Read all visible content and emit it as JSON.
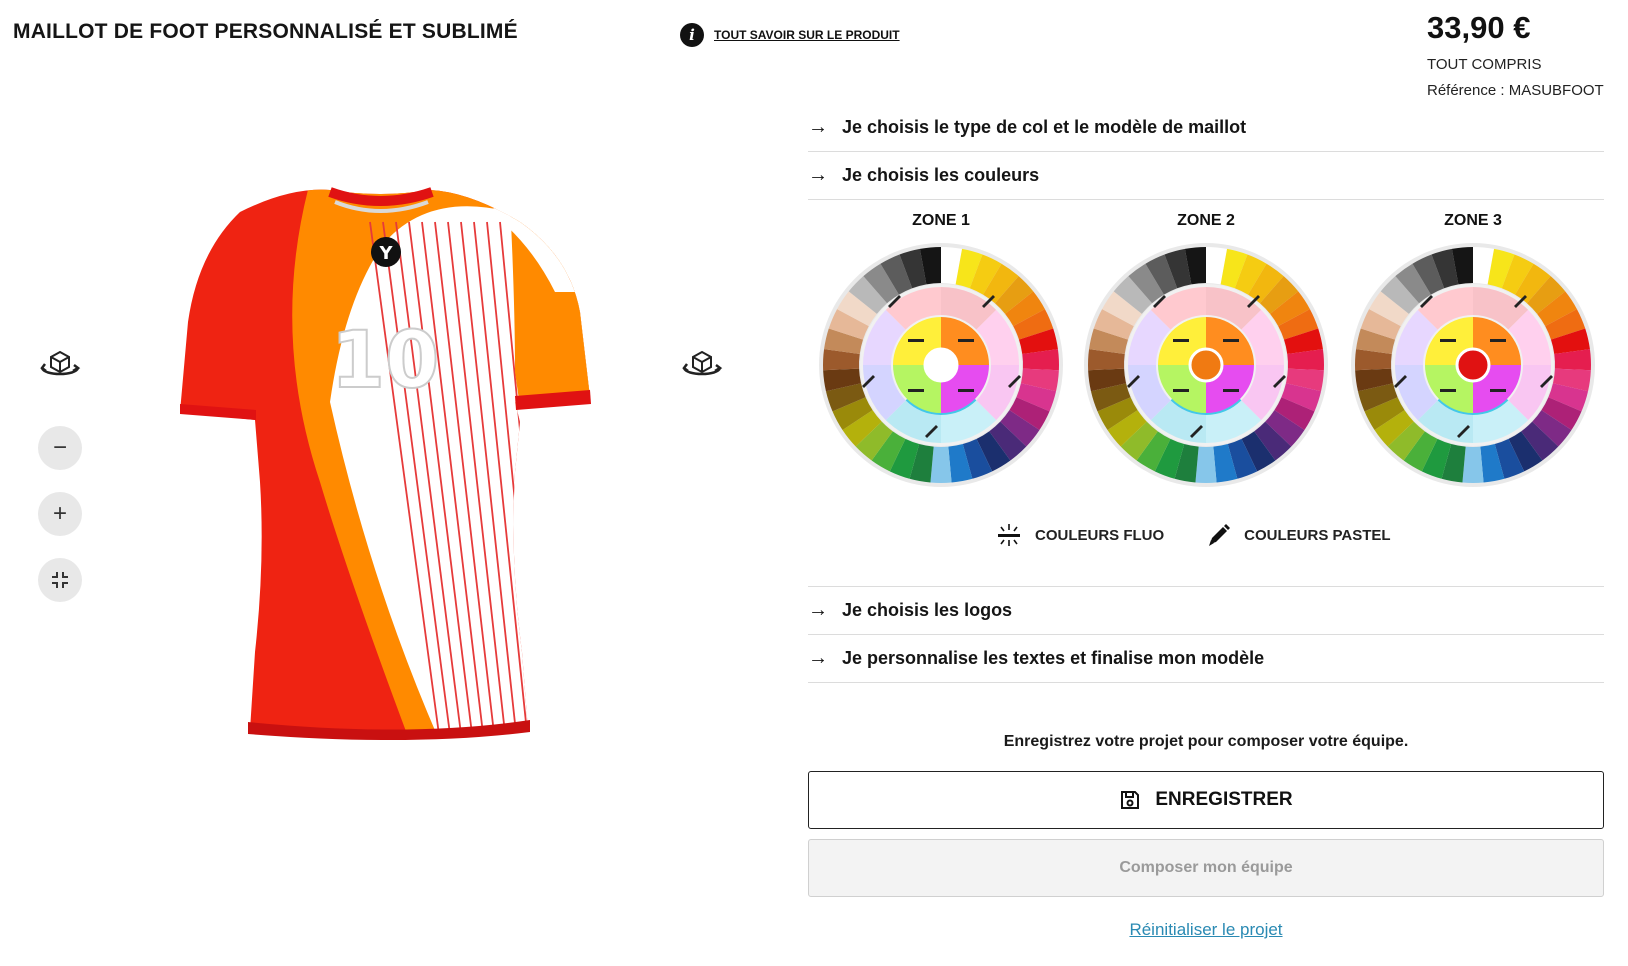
{
  "product": {
    "title": "MAILLOT DE FOOT PERSONNALISÉ ET SUBLIMÉ",
    "info_link": "TOUT SAVOIR SUR LE PRODUIT",
    "price": "33,90 €",
    "price_note": "TOUT COMPRIS",
    "reference": "Référence : MASUBFOOT"
  },
  "jersey": {
    "number": "10",
    "logo_letter": "Y",
    "colors": {
      "zone1": "#ffffff",
      "zone2": "#f07a12",
      "zone3": "#e01212",
      "base_red": "#ef2312",
      "orange": "#ff8a00",
      "stripe": "#e63a3a"
    }
  },
  "tools": {
    "rotate_left_icon": "rotate-3d-icon",
    "rotate_right_icon": "rotate-3d-icon",
    "zoom_out": "−",
    "zoom_in": "+",
    "fit_icon": "compress-icon"
  },
  "steps": [
    {
      "label": "Je choisis le type de col et le modèle de maillot",
      "arrow": "→"
    },
    {
      "label": "Je choisis les couleurs",
      "arrow": "→"
    },
    {
      "label": "Je choisis les logos",
      "arrow": "→"
    },
    {
      "label": "Je personnalise les textes et finalise mon modèle",
      "arrow": "→"
    }
  ],
  "zones": [
    {
      "title": "ZONE 1",
      "selected_color": "#ffffff"
    },
    {
      "title": "ZONE 2",
      "selected_color": "#f07a12"
    },
    {
      "title": "ZONE 3",
      "selected_color": "#e01212"
    }
  ],
  "palette": {
    "outer": [
      "#ffffff",
      "#f7e51a",
      "#f5cc12",
      "#f2b70f",
      "#e79e12",
      "#f0850f",
      "#ef6c12",
      "#e3100f",
      "#e51e4f",
      "#e73a7d",
      "#d8348f",
      "#ad2177",
      "#7e2a86",
      "#4a2a78",
      "#1b2f6e",
      "#1a4e9e",
      "#1f7ac9",
      "#86c6ea",
      "#1e7f3d",
      "#1f9a3f",
      "#4ab03a",
      "#8fbb2a",
      "#b4b10c",
      "#9a8a0a",
      "#7b5a12",
      "#6a3a12",
      "#9c5a2c",
      "#c38a5a",
      "#e6b898",
      "#f1d9c8",
      "#b9b9b9",
      "#8a8a8a",
      "#5c5c5c",
      "#353535",
      "#151515"
    ],
    "pastel": [
      "#f8c2c8",
      "#ffd0ee",
      "#f9c6f2",
      "#c9f0f8",
      "#b9e9f3",
      "#d4d4ff",
      "#e7d7ff",
      "#ffc9cf"
    ],
    "fluo": [
      "#ffef3a",
      "#ff8d1f",
      "#e64cf0",
      "#b5f562"
    ],
    "center_bottom": "#43c8e8"
  },
  "legend": {
    "fluo_label": "COULEURS FLUO",
    "pastel_label": "COULEURS PASTEL"
  },
  "save": {
    "note": "Enregistrez votre projet pour composer votre équipe.",
    "button_label": "ENREGISTRER",
    "team_button": "Composer mon équipe",
    "reset_link": "Réinitialiser le projet"
  }
}
